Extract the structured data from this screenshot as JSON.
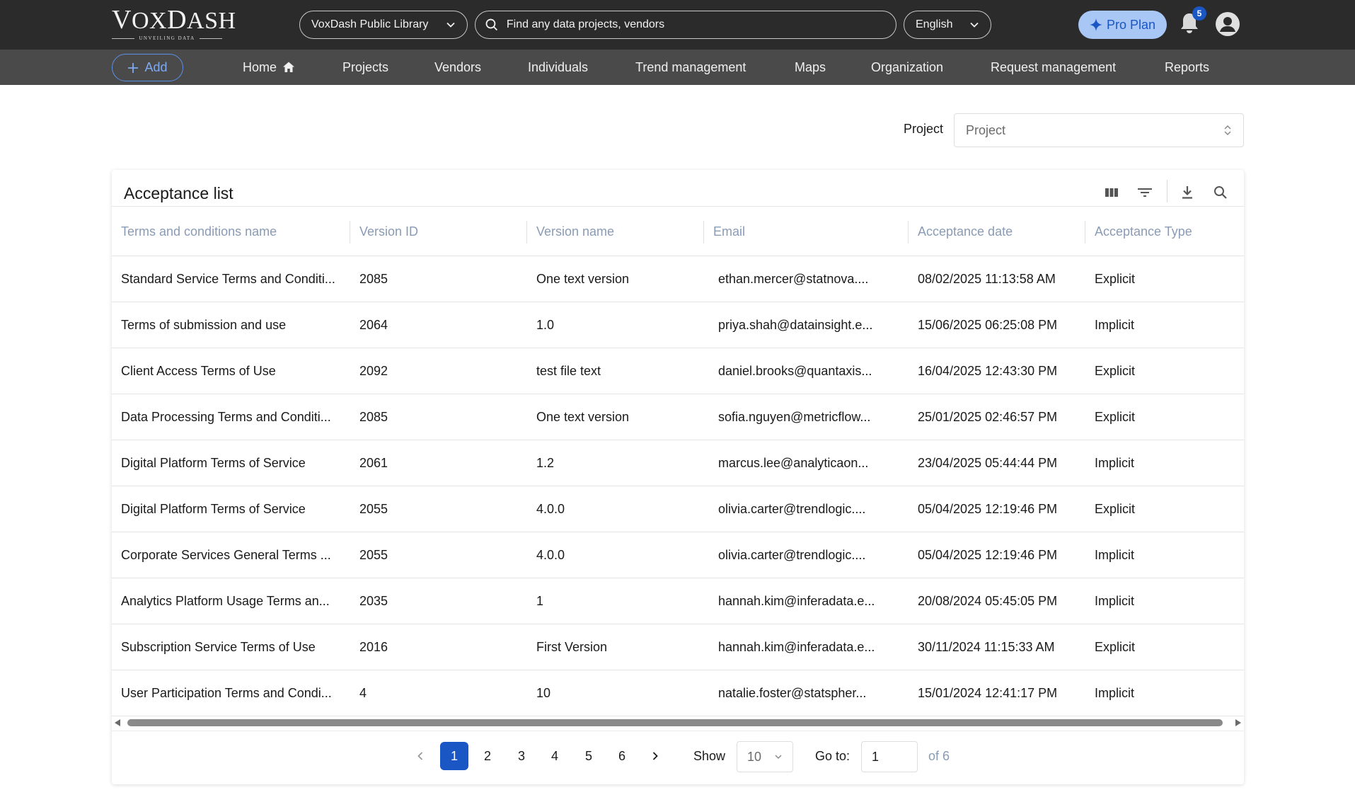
{
  "brand": {
    "name_first": "V",
    "name_rest": "OX",
    "name_first2": "D",
    "name_rest2": "ASH",
    "tagline": "UNVEILING DATA"
  },
  "header": {
    "library": "VoxDash Public Library",
    "search_placeholder": "Find any data projects, vendors",
    "language": "English",
    "pro_plan": "Pro Plan",
    "notifications_count": "5"
  },
  "nav": {
    "add_label": "Add",
    "items": [
      {
        "label": "Home"
      },
      {
        "label": "Projects"
      },
      {
        "label": "Vendors"
      },
      {
        "label": "Individuals"
      },
      {
        "label": "Trend management"
      },
      {
        "label": "Maps"
      },
      {
        "label": "Organization"
      },
      {
        "label": "Request management"
      },
      {
        "label": "Reports"
      }
    ]
  },
  "filter": {
    "label": "Project",
    "placeholder": "Project"
  },
  "table": {
    "title": "Acceptance list",
    "columns": [
      "Terms and conditions name",
      "Version ID",
      "Version name",
      "Email",
      "Acceptance date",
      "Acceptance Type"
    ],
    "rows": [
      [
        "Standard Service Terms and Conditi...",
        "2085",
        "One text version",
        "ethan.mercer@statnova....",
        "08/02/2025 11:13:58 AM",
        "Explicit"
      ],
      [
        "Terms of submission and use",
        "2064",
        "1.0",
        "priya.shah@datainsight.e...",
        "15/06/2025 06:25:08 PM",
        "Implicit"
      ],
      [
        "Client Access Terms of Use",
        "2092",
        "test file text",
        "daniel.brooks@quantaxis...",
        "16/04/2025 12:43:30 PM",
        "Explicit"
      ],
      [
        "Data Processing Terms and Conditi...",
        "2085",
        "One text version",
        "sofia.nguyen@metricflow...",
        "25/01/2025 02:46:57 PM",
        "Explicit"
      ],
      [
        "Digital Platform Terms of Service",
        "2061",
        "1.2",
        "marcus.lee@analyticaon...",
        "23/04/2025 05:44:44 PM",
        "Implicit"
      ],
      [
        "Digital Platform Terms of Service",
        "2055",
        "4.0.0",
        "olivia.carter@trendlogic....",
        "05/04/2025 12:19:46 PM",
        "Explicit"
      ],
      [
        "Corporate Services General Terms ...",
        "2055",
        "4.0.0",
        "olivia.carter@trendlogic....",
        "05/04/2025 12:19:46 PM",
        "Implicit"
      ],
      [
        "Analytics Platform Usage Terms an...",
        "2035",
        "1",
        "hannah.kim@inferadata.e...",
        "20/08/2024 05:45:05 PM",
        "Implicit"
      ],
      [
        "Subscription Service Terms of Use",
        "2016",
        "First Version",
        "hannah.kim@inferadata.e...",
        "30/11/2024 11:15:33 AM",
        "Explicit"
      ],
      [
        "User Participation Terms and Condi...",
        "4",
        "10",
        "natalie.foster@statspher...",
        "15/01/2024 12:41:17 PM",
        "Implicit"
      ]
    ]
  },
  "pagination": {
    "pages": [
      "1",
      "2",
      "3",
      "4",
      "5",
      "6"
    ],
    "current": "1",
    "show_label": "Show",
    "page_size": "10",
    "goto_label": "Go to:",
    "goto_value": "1",
    "of_label": "of 6"
  },
  "colors": {
    "accent": "#1a56c4",
    "topbar": "#2b2b2b",
    "navbar": "#4a4a4a",
    "header_text": "#8a9bb5",
    "pro_plan_bg": "#a9c7f5"
  },
  "icons": [
    "chevron-down-icon",
    "search-icon",
    "sparkle-icon",
    "bell-icon",
    "user-avatar-icon",
    "plus-icon",
    "home-icon",
    "chevron-up-down-icon",
    "columns-icon",
    "filter-icon",
    "download-icon",
    "chevron-left-icon",
    "chevron-right-icon"
  ]
}
